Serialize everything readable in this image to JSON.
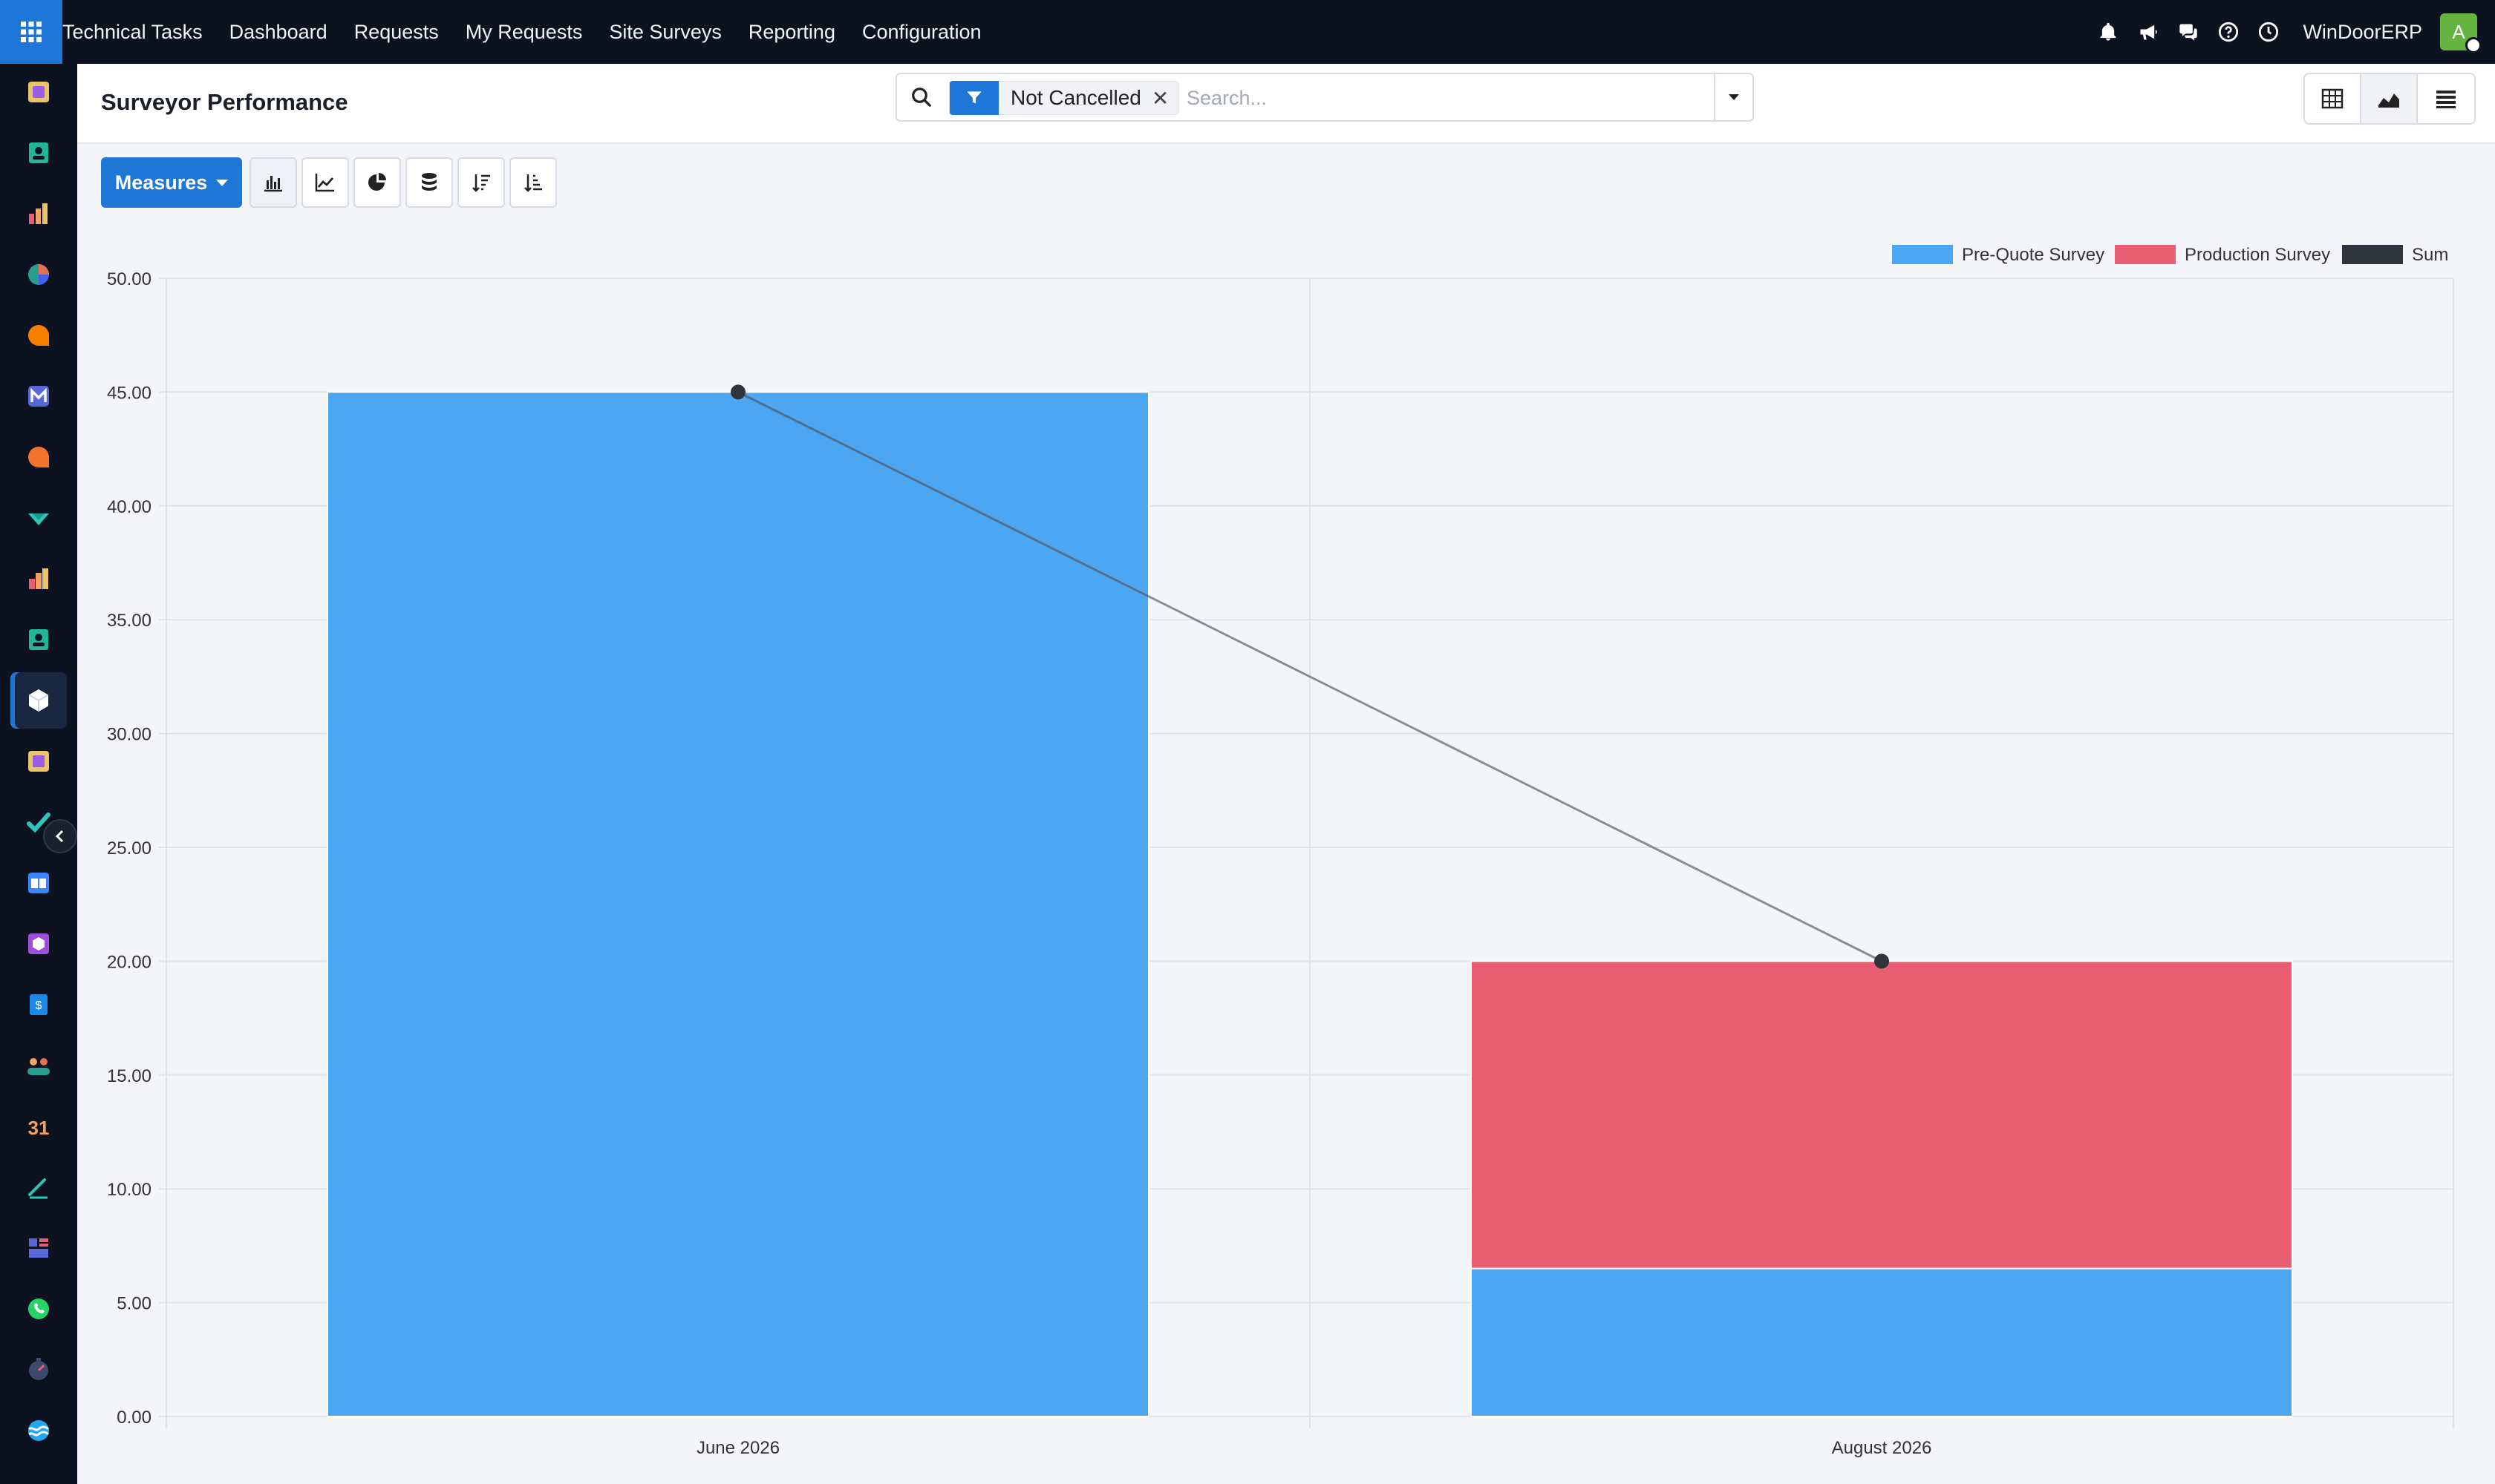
{
  "topbar": {
    "nav": [
      "Technical Tasks",
      "Dashboard",
      "Requests",
      "My Requests",
      "Site Surveys",
      "Reporting",
      "Configuration"
    ],
    "company": "WinDoorERP",
    "avatar_initial": "A"
  },
  "control_panel": {
    "title": "Surveyor Performance",
    "filter_label": "Not Cancelled",
    "search_placeholder": "Search..."
  },
  "toolbar": {
    "measures_label": "Measures"
  },
  "colors": {
    "accent": "#1e76d6",
    "pre_quote": "#4da6f2",
    "production": "#e95e73",
    "sum": "#2f343c"
  },
  "chart_data": {
    "type": "bar",
    "stacked": true,
    "categories": [
      "June 2026",
      "August 2026"
    ],
    "series": [
      {
        "name": "Pre-Quote Survey",
        "values": [
          45,
          6.5
        ]
      },
      {
        "name": "Production Survey",
        "values": [
          0,
          13.5
        ]
      }
    ],
    "line_series": {
      "name": "Sum",
      "values": [
        45,
        20
      ]
    },
    "y_ticks": [
      "0.00",
      "5.00",
      "10.00",
      "15.00",
      "20.00",
      "25.00",
      "30.00",
      "35.00",
      "40.00",
      "45.00",
      "50.00"
    ],
    "ylim": [
      0,
      50
    ],
    "legend_position": "top-right",
    "grid": true
  }
}
